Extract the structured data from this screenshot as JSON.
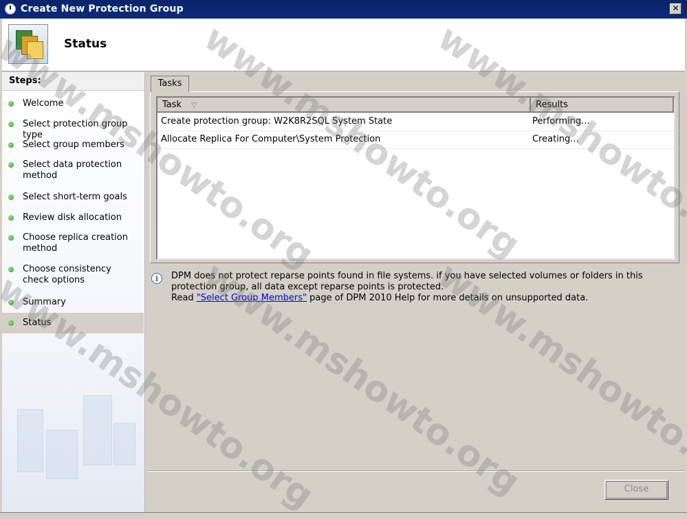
{
  "window": {
    "title": "Create New Protection Group",
    "close_glyph": "✕",
    "icon": "dpm-app-icon"
  },
  "header": {
    "title": "Status",
    "icon": "protection-group-icon"
  },
  "sidebar": {
    "heading": "Steps:",
    "items": [
      {
        "label": "Welcome"
      },
      {
        "label": "Select protection group type"
      },
      {
        "label": "Select group members"
      },
      {
        "label": "Select data protection method"
      },
      {
        "label": "Select short-term goals"
      },
      {
        "label": "Review disk allocation"
      },
      {
        "label": "Choose replica creation method"
      },
      {
        "label": "Choose consistency check options"
      },
      {
        "label": "Summary"
      },
      {
        "label": "Status"
      }
    ],
    "active_index": 9,
    "step_status_color": "#2e9a22"
  },
  "tabs": [
    {
      "label": "Tasks"
    }
  ],
  "tasks_table": {
    "columns": [
      "Task",
      "Results"
    ],
    "sort_glyph": "▽",
    "rows": [
      {
        "task": "Create protection group: W2K8R2SQL System State",
        "result": "Performing..."
      },
      {
        "task": "Allocate Replica For Computer\\System Protection",
        "result": "Creating..."
      }
    ]
  },
  "info": {
    "glyph": "i",
    "line1": "DPM does not protect reparse points found in file systems. if you have selected volumes or folders in this protection group, all data except reparse points is protected.",
    "line2_prefix": "Read ",
    "link_text": "\"Select Group Members\"",
    "line2_suffix": " page of DPM 2010 Help for more details on unsupported data."
  },
  "buttons": {
    "close_label": "Close"
  },
  "watermark": {
    "text": "www.mshowto.org"
  }
}
